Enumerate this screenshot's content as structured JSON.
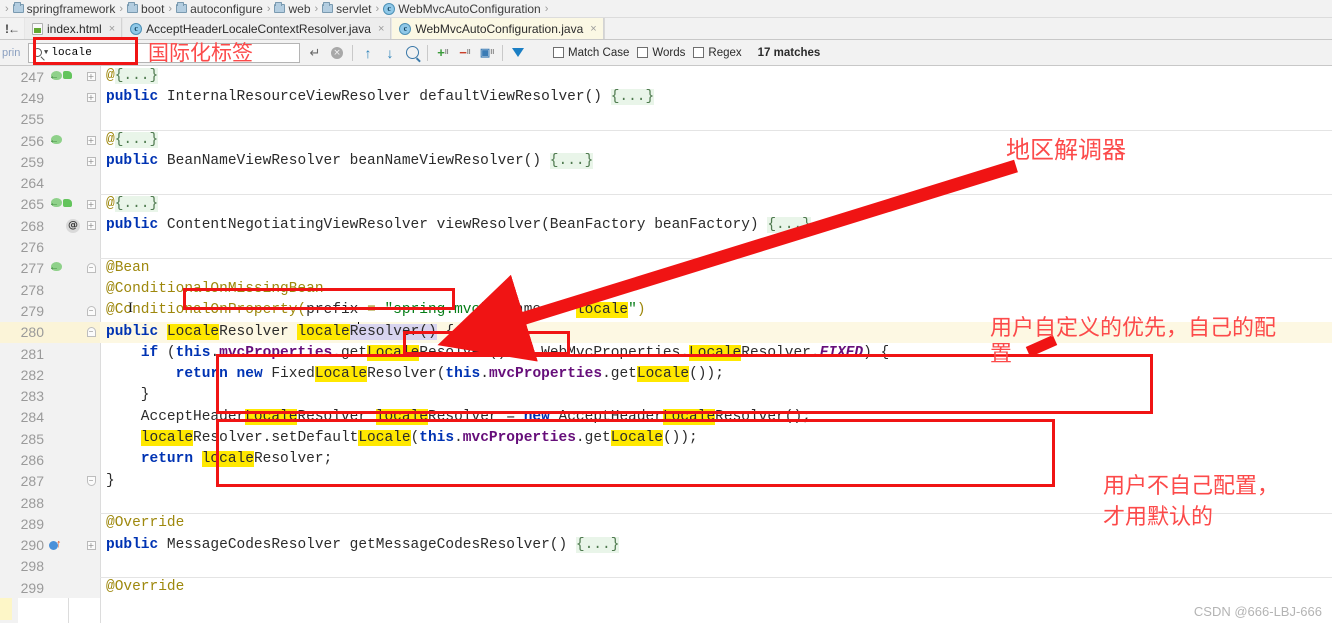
{
  "breadcrumb": {
    "name": "breadcrumb",
    "items": [
      {
        "label": "springframework",
        "icon": "folder-icon"
      },
      {
        "label": "boot",
        "icon": "folder-icon"
      },
      {
        "label": "autoconfigure",
        "icon": "folder-icon"
      },
      {
        "label": "web",
        "icon": "folder-icon"
      },
      {
        "label": "servlet",
        "icon": "folder-icon"
      },
      {
        "label": "WebMvcAutoConfiguration",
        "icon": "class-icon"
      }
    ],
    "separator": "›"
  },
  "tabbar": {
    "gutter_mark": "!←",
    "tabs": [
      {
        "label": "index.html",
        "icon": "html-file-icon",
        "close": "×",
        "active": false
      },
      {
        "label": "AcceptHeaderLocaleContextResolver.java",
        "icon": "class-icon",
        "close": "×",
        "active": false
      },
      {
        "label": "WebMvcAutoConfiguration.java",
        "icon": "class-icon",
        "close": "×",
        "active": true
      }
    ]
  },
  "findbar": {
    "left_ghost": "prin",
    "search_value": "locale",
    "search_placeholder": "Search",
    "enter_icon": "↵",
    "clear_icon": "×",
    "prev_icon": "↑",
    "next_icon": "↓",
    "find_all_icon": "find-all-icon",
    "add_icon": "+",
    "remove_icon": "−",
    "select_occurrence_icon": "▣",
    "filter_icon": "filter-icon",
    "sub_label": "II",
    "checkboxes": [
      {
        "label": "Match Case",
        "checked": false,
        "mnemonic": "C"
      },
      {
        "label": "Words",
        "checked": false,
        "mnemonic": "o"
      },
      {
        "label": "Regex",
        "checked": false,
        "mnemonic": "e"
      }
    ],
    "matches": "17 matches"
  },
  "annotations": {
    "search_label": "国际化标签",
    "locale_resolver": "地区解调器",
    "user_custom_priority": "用户自定义的优先，自己的配",
    "user_custom_priority_line2": "置",
    "default_note_line1": "用户不自己配置，",
    "default_note_line2": "才用默认的"
  },
  "watermark": "CSDN @666-LBJ-666",
  "colors": {
    "annotation_red": "#fc4a4a",
    "box_red": "#f01414",
    "highlight_yellow": "#ffe800",
    "current_line": "#fdf8e3",
    "keyword_blue": "#0033b3",
    "annotation_gold": "#9e880d",
    "string_green": "#067d17"
  },
  "editor": {
    "current_line": 280,
    "lines": [
      {
        "num": "247",
        "icons": [
          "bean-icon",
          "bean-overlay-icon"
        ],
        "fold": "plus",
        "sep_above": false
      },
      {
        "num": "249",
        "icons": [],
        "fold": "plus",
        "sep_above": false
      },
      {
        "num": "255",
        "icons": [],
        "fold": "none",
        "sep_above": false
      },
      {
        "num": "256",
        "icons": [
          "bean-icon"
        ],
        "fold": "plus",
        "sep_above": true
      },
      {
        "num": "259",
        "icons": [],
        "fold": "plus",
        "sep_above": false
      },
      {
        "num": "264",
        "icons": [],
        "fold": "none",
        "sep_above": false
      },
      {
        "num": "265",
        "icons": [
          "bean-icon",
          "bean-overlay-icon"
        ],
        "fold": "plus",
        "sep_above": true
      },
      {
        "num": "268",
        "icons": [
          "at-icon"
        ],
        "fold": "plus",
        "sep_above": false
      },
      {
        "num": "276",
        "icons": [],
        "fold": "none",
        "sep_above": false
      },
      {
        "num": "277",
        "icons": [
          "bean-icon"
        ],
        "fold": "foldtop",
        "sep_above": true
      },
      {
        "num": "278",
        "icons": [],
        "fold": "bar",
        "sep_above": false
      },
      {
        "num": "279",
        "icons": [],
        "fold": "bar",
        "sep_above": false
      },
      {
        "num": "280",
        "icons": [],
        "fold": "foldtop2",
        "sep_above": false
      },
      {
        "num": "281",
        "icons": [],
        "fold": "none",
        "sep_above": false
      },
      {
        "num": "282",
        "icons": [],
        "fold": "none",
        "sep_above": false
      },
      {
        "num": "283",
        "icons": [],
        "fold": "none",
        "sep_above": false
      },
      {
        "num": "284",
        "icons": [],
        "fold": "none",
        "sep_above": false
      },
      {
        "num": "285",
        "icons": [],
        "fold": "none",
        "sep_above": false
      },
      {
        "num": "286",
        "icons": [],
        "fold": "none",
        "sep_above": false
      },
      {
        "num": "287",
        "icons": [],
        "fold": "foldbot",
        "sep_above": false
      },
      {
        "num": "288",
        "icons": [],
        "fold": "none",
        "sep_above": false
      },
      {
        "num": "289",
        "icons": [],
        "fold": "none",
        "sep_above": true
      },
      {
        "num": "290",
        "icons": [
          "override-icon"
        ],
        "fold": "plus",
        "sep_above": false
      },
      {
        "num": "298",
        "icons": [],
        "fold": "none",
        "sep_above": false
      },
      {
        "num": "299",
        "icons": [],
        "fold": "none",
        "sep_above": true
      }
    ],
    "code_text": [
      "@{...}",
      "public InternalResourceViewResolver defaultViewResolver() {...}",
      "",
      "@{...}",
      "public BeanNameViewResolver beanNameViewResolver() {...}",
      "",
      "@{...}",
      "public ContentNegotiatingViewResolver viewResolver(BeanFactory beanFactory) {...}",
      "",
      "@Bean",
      "@ConditionalOnMissingBean",
      "@ConditionalOnProperty(prefix = \"spring.mvc\", name = \"locale\")",
      "public LocaleResolver localeResolver() {",
      "    if (this.mvcProperties.getLocaleResolver() == WebMvcProperties.LocaleResolver.FIXED) {",
      "        return new FixedLocaleResolver(this.mvcProperties.getLocale());",
      "    }",
      "    AcceptHeaderLocaleResolver localeResolver = new AcceptHeaderLocaleResolver();",
      "    localeResolver.setDefaultLocale(this.mvcProperties.getLocale());",
      "    return localeResolver;",
      "}",
      "",
      "@Override",
      "public MessageCodesResolver getMessageCodesResolver() {...}",
      "",
      "@Override"
    ]
  }
}
